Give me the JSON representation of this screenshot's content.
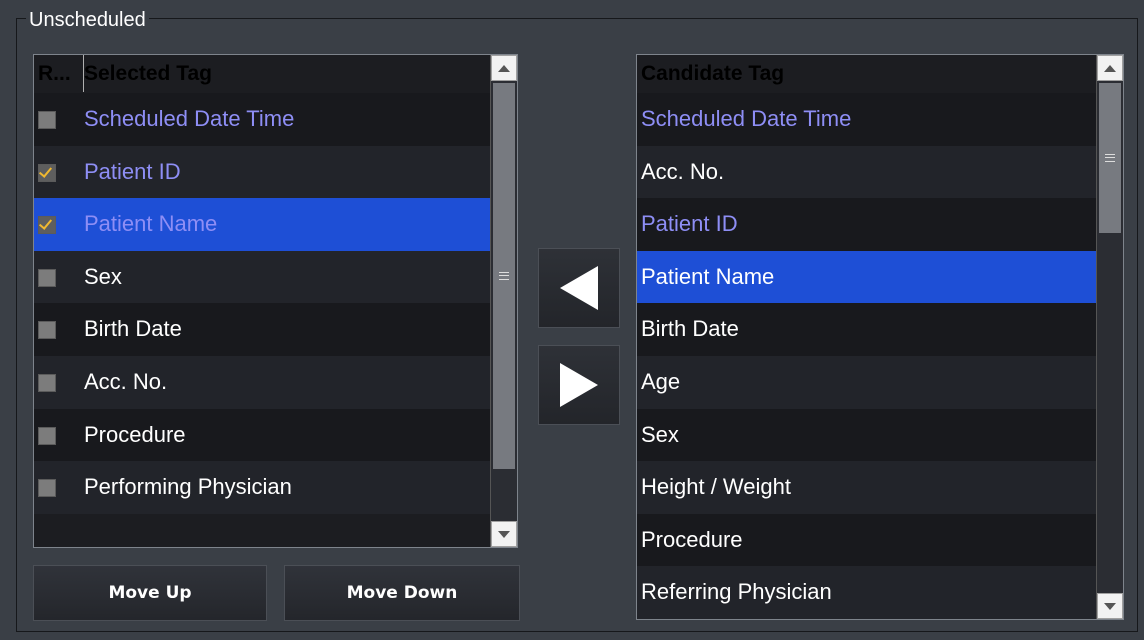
{
  "group": {
    "title": "Unscheduled"
  },
  "selected_list": {
    "header_r": "R...",
    "header_tag": "Selected Tag",
    "items": [
      {
        "label": "Scheduled Date Time",
        "checked": false,
        "style": "purple",
        "selected": false
      },
      {
        "label": "Patient ID",
        "checked": true,
        "style": "purple",
        "selected": false
      },
      {
        "label": "Patient Name",
        "checked": true,
        "style": "purple",
        "selected": true
      },
      {
        "label": "Sex",
        "checked": false,
        "style": "normal",
        "selected": false
      },
      {
        "label": "Birth Date",
        "checked": false,
        "style": "normal",
        "selected": false
      },
      {
        "label": "Acc. No.",
        "checked": false,
        "style": "normal",
        "selected": false
      },
      {
        "label": "Procedure",
        "checked": false,
        "style": "normal",
        "selected": false
      },
      {
        "label": "Performing Physician",
        "checked": false,
        "style": "normal",
        "selected": false
      }
    ]
  },
  "candidate_list": {
    "header_tag": "Candidate Tag",
    "items": [
      {
        "label": "Scheduled Date Time",
        "style": "purple",
        "selected": false
      },
      {
        "label": "Acc. No.",
        "style": "normal",
        "selected": false
      },
      {
        "label": "Patient ID",
        "style": "purple",
        "selected": false
      },
      {
        "label": "Patient Name",
        "style": "normal",
        "selected": true
      },
      {
        "label": "Birth Date",
        "style": "normal",
        "selected": false
      },
      {
        "label": "Age",
        "style": "normal",
        "selected": false
      },
      {
        "label": "Sex",
        "style": "normal",
        "selected": false
      },
      {
        "label": "Height / Weight",
        "style": "normal",
        "selected": false
      },
      {
        "label": "Procedure",
        "style": "normal",
        "selected": false
      },
      {
        "label": "Referring Physician",
        "style": "normal",
        "selected": false
      }
    ]
  },
  "buttons": {
    "move_up": "Move Up",
    "move_down": "Move Down",
    "add_icon": "left-arrow-icon",
    "remove_icon": "right-arrow-icon"
  },
  "colors": {
    "selection": "#1e4fd6",
    "purple_text": "#8e8ef5",
    "check": "#f0b830"
  }
}
